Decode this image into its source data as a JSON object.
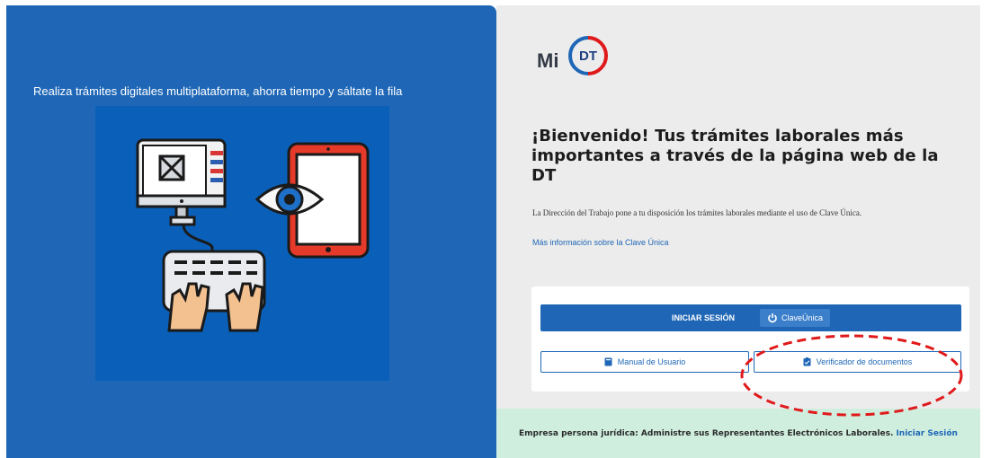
{
  "left": {
    "tagline": "Realiza trámites digitales multiplataforma, ahorra tiempo y sáltate la fila",
    "panel_color": "#1f67b6",
    "illustration": "computer-tablet-eye-keyboard-illustration"
  },
  "logo": {
    "mi": "Mi",
    "dt": "DT"
  },
  "main": {
    "welcome": "¡Bienvenido! Tus trámites laborales más importantes a través de la página web de la DT",
    "description": "La Dirección del Trabajo pone a tu disposición los trámites laborales mediante el uso de Clave Única.",
    "more_info_link": "Más información sobre la Clave Única"
  },
  "login": {
    "label": "INICIAR SESIÓN",
    "clave_unica": "ClaveÚnica",
    "manual_button": "Manual de Usuario",
    "verifier_button": "Verificador de documentos"
  },
  "footer": {
    "text": "Empresa persona jurídica: Administre sus Representantes Electrónicos Laborales.",
    "link": "Iniciar Sesión",
    "background": "#cfeede"
  },
  "colors": {
    "primary_blue": "#1f67b6",
    "annotation_red": "#e0191b"
  }
}
